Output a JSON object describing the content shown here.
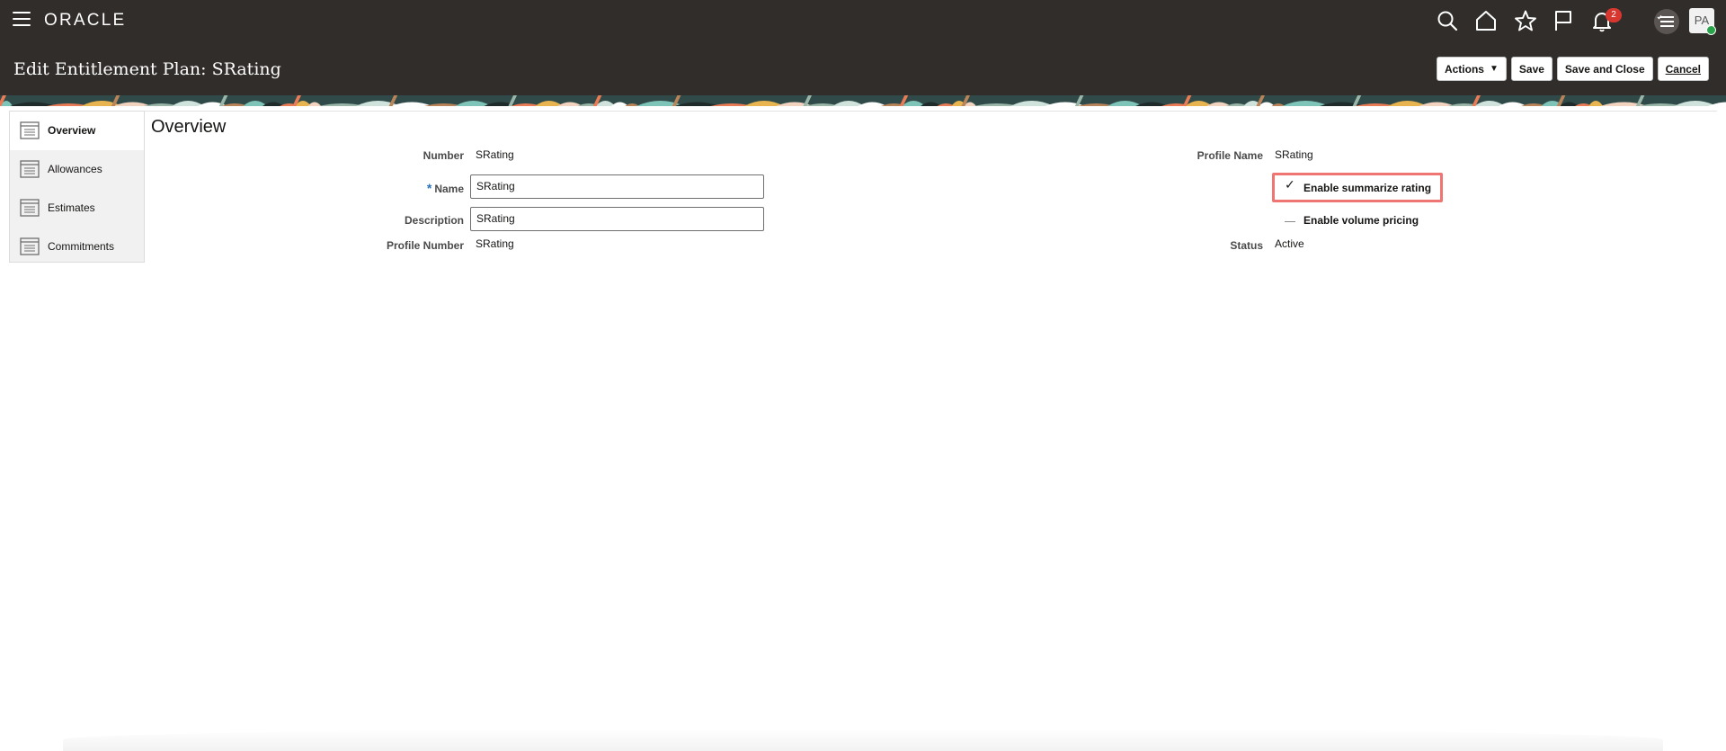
{
  "header": {
    "logo_text": "ORACLE",
    "notification_count": "2",
    "avatar_initials": "PA"
  },
  "page": {
    "title": "Edit Entitlement Plan: SRating"
  },
  "toolbar": {
    "actions_label": "Actions",
    "save_label": "Save",
    "save_close_label": "Save and Close",
    "cancel_label": "Cancel"
  },
  "sidebar": {
    "items": [
      {
        "label": "Overview",
        "active": true
      },
      {
        "label": "Allowances",
        "active": false
      },
      {
        "label": "Estimates",
        "active": false
      },
      {
        "label": "Commitments",
        "active": false
      }
    ]
  },
  "overview": {
    "section_title": "Overview",
    "number_label": "Number",
    "number_value": "SRating",
    "name_label": "Name",
    "name_value": "SRating",
    "description_label": "Description",
    "description_value": "SRating",
    "profile_number_label": "Profile Number",
    "profile_number_value": "SRating",
    "profile_name_label": "Profile Name",
    "profile_name_value": "SRating",
    "enable_summarize_label": "Enable summarize rating",
    "enable_summarize_checked": true,
    "enable_volume_label": "Enable volume pricing",
    "enable_volume_checked": false,
    "status_label": "Status",
    "status_value": "Active"
  },
  "colors": {
    "header_bg": "#312d2a",
    "highlight": "#ee7572",
    "required": "#2a73b8"
  }
}
